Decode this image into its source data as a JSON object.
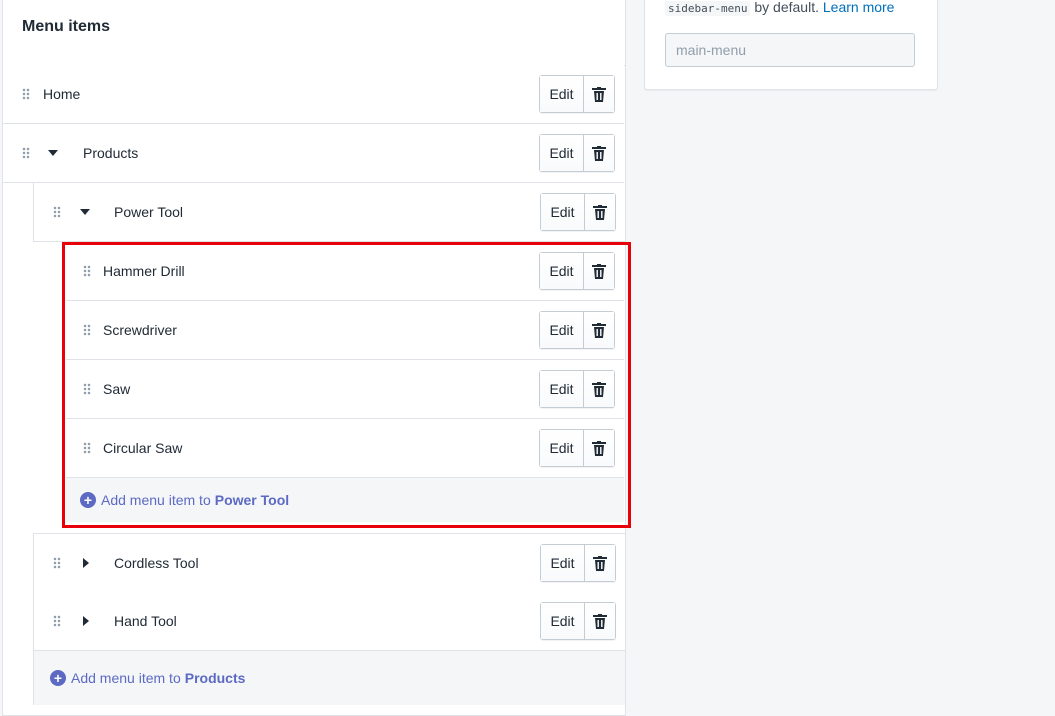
{
  "card": {
    "title": "Menu items",
    "edit_label": "Edit",
    "items": {
      "home": "Home",
      "products": "Products",
      "power_tool": "Power Tool",
      "hammer_drill": "Hammer Drill",
      "screwdriver": "Screwdriver",
      "saw": "Saw",
      "circular_saw": "Circular Saw",
      "cordless_tool": "Cordless Tool",
      "hand_tool": "Hand Tool"
    },
    "add_power_tool": {
      "prefix": "Add menu item to",
      "target": "Power Tool"
    },
    "add_products": {
      "prefix": "Add menu item to",
      "target": "Products"
    }
  },
  "sidebar": {
    "code_text": "sidebar-menu",
    "text_after": "by default.",
    "learn_more": "Learn more",
    "handle_input": {
      "value": "",
      "placeholder": "main-menu"
    }
  },
  "icons": {
    "drag": "drag-handle-icon",
    "expand": "caret-down-icon",
    "collapse": "caret-right-icon",
    "delete": "trash-icon",
    "add": "plus-circle-icon"
  },
  "colors": {
    "accent": "#5c6ac4",
    "link": "#006fbb",
    "highlight": "#e8000b",
    "border": "#dfe3e8"
  }
}
